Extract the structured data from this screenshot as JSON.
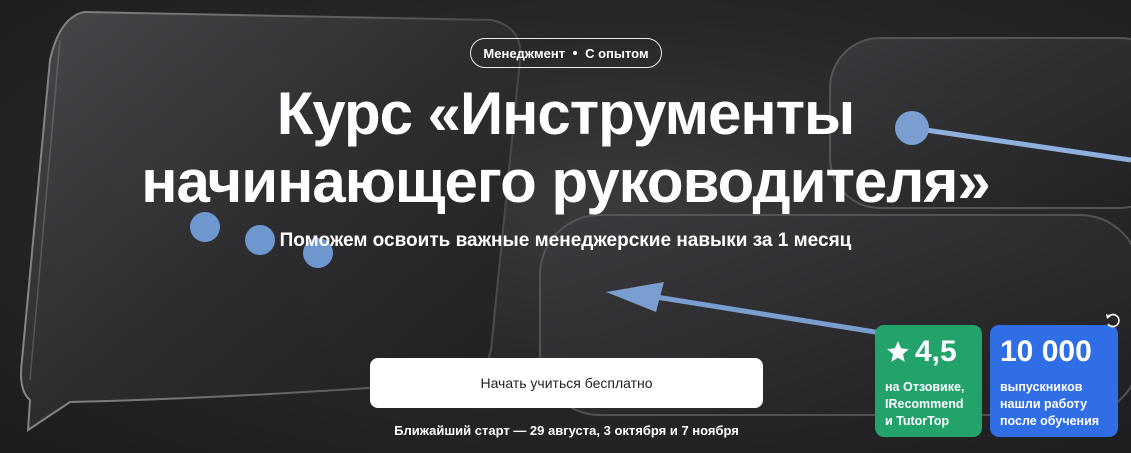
{
  "tag": {
    "category": "Менеджмент",
    "level": "С опытом"
  },
  "hero": {
    "title_line1": "Курс «Инструменты",
    "title_line2": "начинающего руководителя»",
    "subtitle": "Поможем освоить важные менеджерские навыки за 1 месяц"
  },
  "cta": {
    "button_label": "Начать учиться бесплатно",
    "start_dates": "Ближайший старт — 29 августа, 3 октября и 7 ноября"
  },
  "badges": {
    "rating": {
      "value": "4,5",
      "line1": "на Отзовике,",
      "line2": "IRecommend",
      "line3": "и TutorTop",
      "color": "#21a36b"
    },
    "graduates": {
      "value": "10 000",
      "line1": "выпускников",
      "line2": "нашли работу",
      "line3": "после обучения",
      "color": "#2f6ee5"
    }
  },
  "icons": {
    "star": "star-icon",
    "rotate": "rotate-icon"
  },
  "colors": {
    "accent_dots": "#7a9ed0",
    "background": "#2a2a2c"
  }
}
